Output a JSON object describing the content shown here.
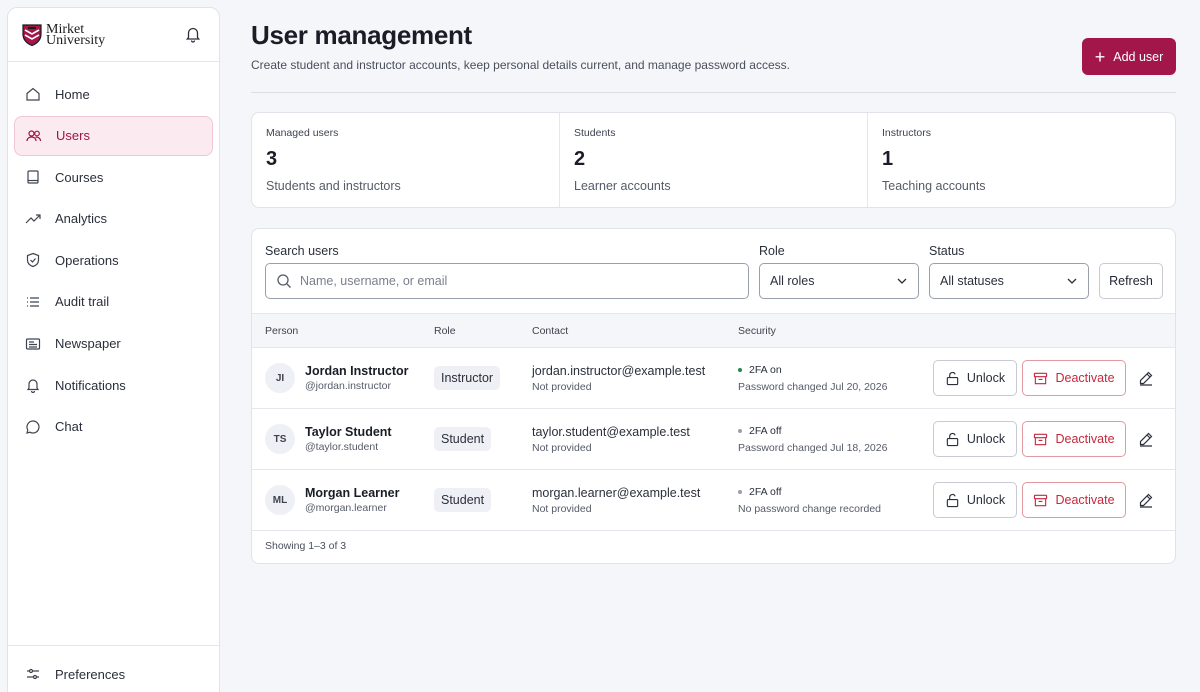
{
  "brand": {
    "line1": "Mirket",
    "line2": "University"
  },
  "sidebar": {
    "items": [
      {
        "label": "Home",
        "icon": "home-icon"
      },
      {
        "label": "Users",
        "icon": "users-icon",
        "active": true
      },
      {
        "label": "Courses",
        "icon": "book-icon"
      },
      {
        "label": "Analytics",
        "icon": "trend-icon"
      },
      {
        "label": "Operations",
        "icon": "shield-check-icon"
      },
      {
        "label": "Audit trail",
        "icon": "list-icon"
      },
      {
        "label": "Newspaper",
        "icon": "newspaper-icon"
      },
      {
        "label": "Notifications",
        "icon": "bell-icon"
      },
      {
        "label": "Chat",
        "icon": "chat-icon"
      }
    ],
    "preferences": "Preferences"
  },
  "header": {
    "title": "User management",
    "subtitle": "Create student and instructor accounts, keep personal details current, and manage password access.",
    "add_label": "Add user"
  },
  "stats": [
    {
      "label": "Managed users",
      "value": "3",
      "desc": "Students and instructors"
    },
    {
      "label": "Students",
      "value": "2",
      "desc": "Learner accounts"
    },
    {
      "label": "Instructors",
      "value": "1",
      "desc": "Teaching accounts"
    }
  ],
  "filters": {
    "search_label": "Search users",
    "search_placeholder": "Name, username, or email",
    "role_label": "Role",
    "role_value": "All roles",
    "status_label": "Status",
    "status_value": "All statuses",
    "refresh": "Refresh"
  },
  "table": {
    "columns": {
      "person": "Person",
      "role": "Role",
      "contact": "Contact",
      "security": "Security"
    },
    "rows": [
      {
        "initials": "JI",
        "name": "Jordan Instructor",
        "username": "@jordan.instructor",
        "role": "Instructor",
        "email": "jordan.instructor@example.test",
        "phone": "Not provided",
        "twofa": "2FA on",
        "twofa_color": "#1f8a4c",
        "password": "Password changed Jul 20, 2026"
      },
      {
        "initials": "TS",
        "name": "Taylor Student",
        "username": "@taylor.student",
        "role": "Student",
        "email": "taylor.student@example.test",
        "phone": "Not provided",
        "twofa": "2FA off",
        "twofa_color": "#9aa0ab",
        "password": "Password changed Jul 18, 2026"
      },
      {
        "initials": "ML",
        "name": "Morgan Learner",
        "username": "@morgan.learner",
        "role": "Student",
        "email": "morgan.learner@example.test",
        "phone": "Not provided",
        "twofa": "2FA off",
        "twofa_color": "#9aa0ab",
        "password": "No password change recorded"
      }
    ],
    "unlock_label": "Unlock",
    "deactivate_label": "Deactivate",
    "footer": "Showing 1–3 of 3"
  },
  "colors": {
    "accent": "#a3164a",
    "danger": "#c5283c"
  }
}
